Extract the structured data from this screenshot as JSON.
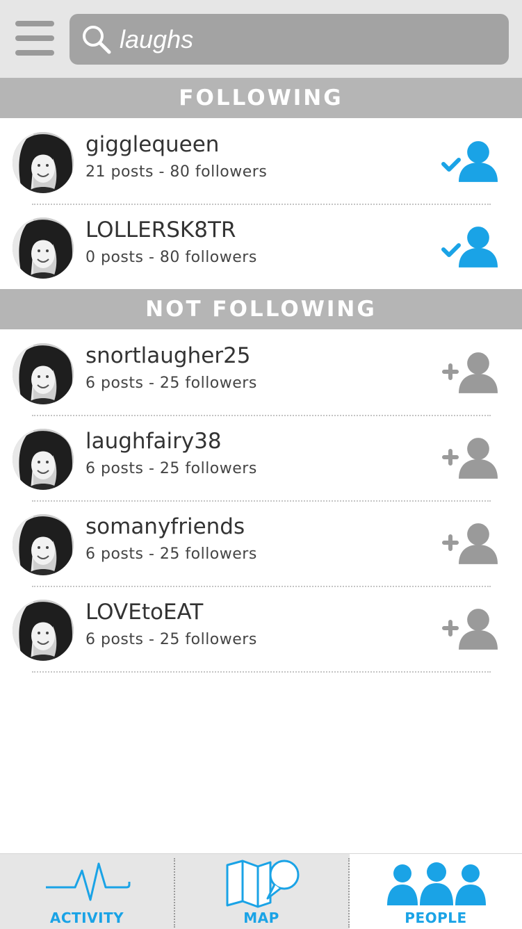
{
  "search": {
    "query": "laughs"
  },
  "sections": {
    "following": "FOLLOWING",
    "not_following": "NOT FOLLOWING"
  },
  "following": [
    {
      "username": "gigglequeen",
      "stats": "21 posts - 80 followers",
      "status": "following"
    },
    {
      "username": "LOLLERSK8TR",
      "stats": "0 posts - 80 followers",
      "status": "following"
    }
  ],
  "not_following": [
    {
      "username": "snortlaugher25",
      "stats": "6 posts - 25 followers",
      "status": "not-following"
    },
    {
      "username": "laughfairy38",
      "stats": "6 posts - 25 followers",
      "status": "not-following"
    },
    {
      "username": "somanyfriends",
      "stats": "6 posts - 25 followers",
      "status": "not-following"
    },
    {
      "username": "LOVEtoEAT",
      "stats": "6 posts - 25 followers",
      "status": "not-following"
    }
  ],
  "tabs": [
    {
      "label": "ACTIVITY",
      "icon": "activity-pulse-icon",
      "active": false
    },
    {
      "label": "MAP",
      "icon": "map-chat-icon",
      "active": false
    },
    {
      "label": "PEOPLE",
      "icon": "people-group-icon",
      "active": true
    }
  ],
  "colors": {
    "accent": "#1aa3e6",
    "header_gray": "#b5b5b5",
    "topbar_gray": "#e6e6e6",
    "search_gray": "#a3a3a3",
    "inactive_icon": "#9a9a9a"
  }
}
